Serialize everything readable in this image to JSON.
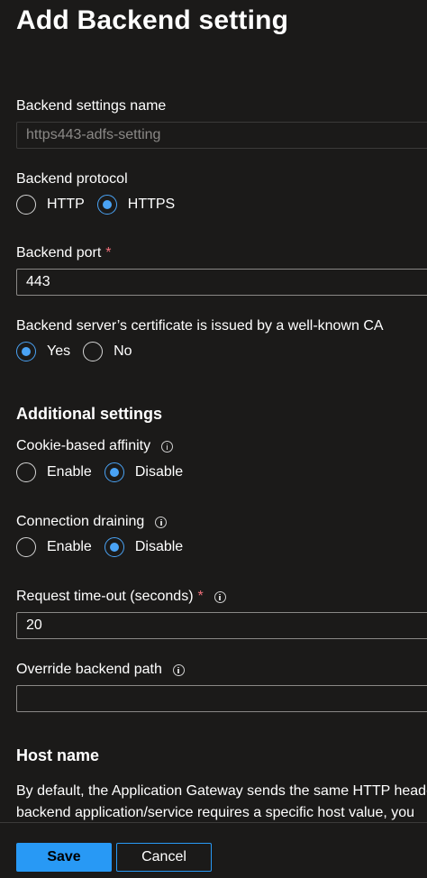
{
  "panel": {
    "title": "Add Backend setting"
  },
  "fields": {
    "backend_settings_name": {
      "label": "Backend settings name",
      "value": "https443-adfs-setting"
    },
    "backend_protocol": {
      "label": "Backend protocol",
      "options": [
        "HTTP",
        "HTTPS"
      ],
      "selected": "HTTPS"
    },
    "backend_port": {
      "label": "Backend port",
      "required_marker": "*",
      "value": "443"
    },
    "well_known_ca": {
      "label": "Backend server’s certificate is issued by a well-known CA",
      "options": [
        "Yes",
        "No"
      ],
      "selected": "Yes"
    }
  },
  "additional": {
    "heading": "Additional settings",
    "cookie_affinity": {
      "label": "Cookie-based affinity",
      "options": [
        "Enable",
        "Disable"
      ],
      "selected": "Disable"
    },
    "connection_draining": {
      "label": "Connection draining",
      "options": [
        "Enable",
        "Disable"
      ],
      "selected": "Disable"
    },
    "request_timeout": {
      "label": "Request time-out (seconds)",
      "required_marker": "*",
      "value": "20"
    },
    "override_path": {
      "label": "Override backend path",
      "value": ""
    }
  },
  "host_name": {
    "heading": "Host name",
    "description_line1": "By default, the Application Gateway sends the same HTTP header",
    "description_line2": "backend application/service requires a specific host value, you"
  },
  "footer": {
    "save_label": "Save",
    "cancel_label": "Cancel"
  },
  "colors": {
    "background": "#1b1a19",
    "accent": "#2899f5",
    "radio_checked": "#4aa3f5",
    "required": "#f1707b"
  }
}
